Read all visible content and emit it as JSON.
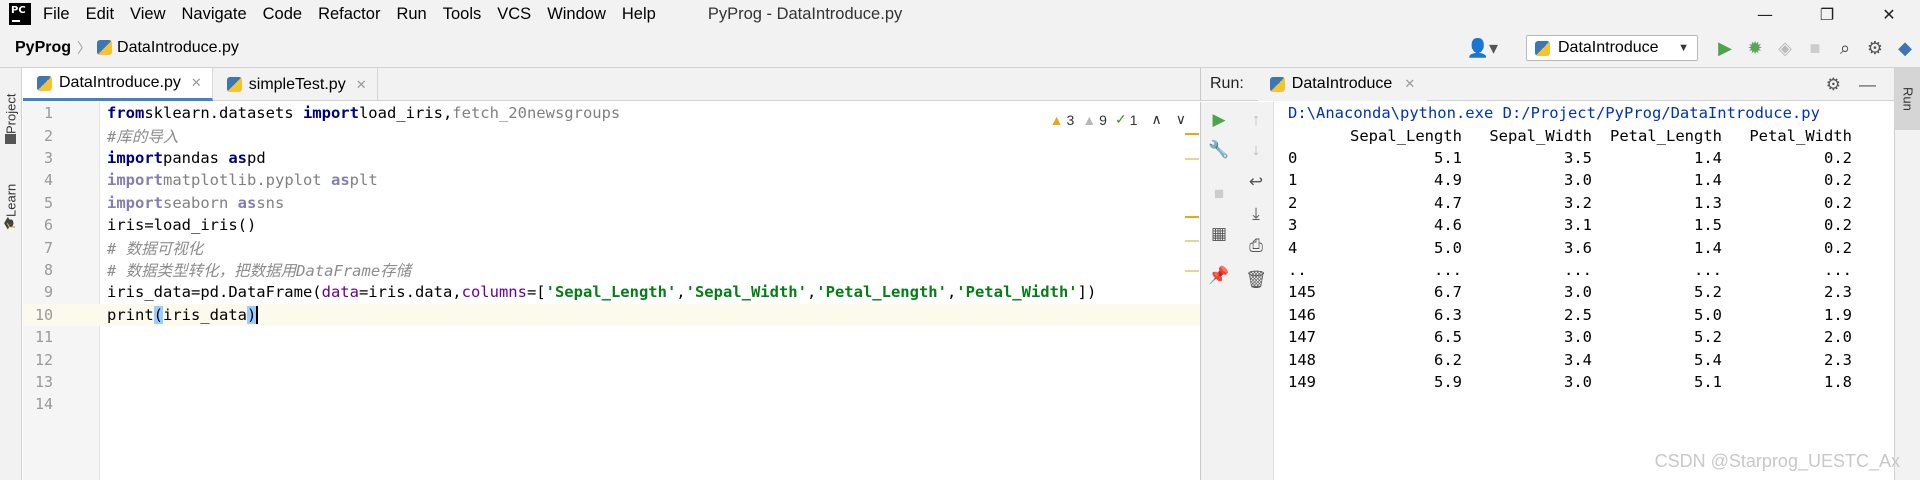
{
  "window": {
    "app_icon": "PC",
    "title": "PyProg - DataIntroduce.py",
    "menu": [
      "File",
      "Edit",
      "View",
      "Navigate",
      "Code",
      "Refactor",
      "Run",
      "Tools",
      "VCS",
      "Window",
      "Help"
    ],
    "controls": {
      "minimize": "—",
      "restore": "❐",
      "close": "✕"
    }
  },
  "navbar": {
    "project": "PyProg",
    "file": "DataIntroduce.py",
    "run_config": "DataIntroduce"
  },
  "left_strip": {
    "project_label": "Project",
    "learn_label": "Learn"
  },
  "editor": {
    "tabs": [
      {
        "label": "DataIntroduce.py",
        "active": true
      },
      {
        "label": "simpleTest.py",
        "active": false
      }
    ],
    "inspections": {
      "warnings": "3",
      "weak_warnings": "9",
      "typos": "1"
    },
    "lines": [
      {
        "n": "1",
        "parts": [
          [
            "kw",
            "from"
          ],
          [
            "",
            "sklearn.datasets "
          ],
          [
            "kw",
            "import"
          ],
          [
            "",
            "load_iris,"
          ],
          [
            "dim",
            "fetch_20newsgroups"
          ]
        ]
      },
      {
        "n": "2",
        "parts": [
          [
            "cmt",
            "#库的导入"
          ]
        ]
      },
      {
        "n": "3",
        "parts": [
          [
            "kw",
            "import"
          ],
          [
            "",
            "pandas "
          ],
          [
            "kw",
            "as"
          ],
          [
            "",
            "pd"
          ]
        ]
      },
      {
        "n": "4",
        "parts": [
          [
            "dimkw",
            "import"
          ],
          [
            "dim",
            "matplotlib.pyplot "
          ],
          [
            "dimkw",
            "as"
          ],
          [
            "dim",
            "plt"
          ]
        ]
      },
      {
        "n": "5",
        "parts": [
          [
            "dimkw",
            "import"
          ],
          [
            "dim",
            "seaborn "
          ],
          [
            "dimkw",
            "as"
          ],
          [
            "dim",
            "sns"
          ]
        ]
      },
      {
        "n": "6",
        "parts": [
          [
            "",
            "iris=load_iris()"
          ]
        ]
      },
      {
        "n": "7",
        "parts": [
          [
            "cmt",
            "# 数据可视化"
          ]
        ]
      },
      {
        "n": "8",
        "parts": [
          [
            "cmt",
            "# 数据类型转化，把数据用DataFrame存储"
          ]
        ]
      },
      {
        "n": "9",
        "parts": [
          [
            "",
            "iris_data=pd.DataFrame("
          ],
          [
            "param",
            "data"
          ],
          [
            "",
            "=iris.data,"
          ],
          [
            "param",
            "columns"
          ],
          [
            "",
            "=["
          ],
          [
            "str",
            "'Sepal_Length'"
          ],
          [
            "",
            ","
          ],
          [
            "str",
            "'Sepal_Width'"
          ],
          [
            "",
            ","
          ],
          [
            "str",
            "'Petal_Length'"
          ],
          [
            "",
            ","
          ],
          [
            "str",
            "'Petal_Width'"
          ],
          [
            "",
            "])"
          ]
        ]
      },
      {
        "n": "10",
        "parts": [
          [
            "",
            "print"
          ],
          [
            "br",
            "("
          ],
          [
            "",
            "iris_data"
          ],
          [
            "br",
            ")"
          ]
        ],
        "current": true
      },
      {
        "n": "11",
        "parts": []
      },
      {
        "n": "12",
        "parts": []
      },
      {
        "n": "13",
        "parts": []
      },
      {
        "n": "14",
        "parts": []
      }
    ]
  },
  "run": {
    "label": "Run:",
    "tab": "DataIntroduce",
    "command": "D:\\Anaconda\\python.exe D:/Project/PyProg/DataIntroduce.py",
    "header": [
      "",
      "Sepal_Length",
      "Sepal_Width",
      "Petal_Length",
      "Petal_Width"
    ],
    "rows": [
      [
        "0",
        "5.1",
        "3.5",
        "1.4",
        "0.2"
      ],
      [
        "1",
        "4.9",
        "3.0",
        "1.4",
        "0.2"
      ],
      [
        "2",
        "4.7",
        "3.2",
        "1.3",
        "0.2"
      ],
      [
        "3",
        "4.6",
        "3.1",
        "1.5",
        "0.2"
      ],
      [
        "4",
        "5.0",
        "3.6",
        "1.4",
        "0.2"
      ],
      [
        "..",
        "...",
        "...",
        "...",
        "..."
      ],
      [
        "145",
        "6.7",
        "3.0",
        "5.2",
        "2.3"
      ],
      [
        "146",
        "6.3",
        "2.5",
        "5.0",
        "1.9"
      ],
      [
        "147",
        "6.5",
        "3.0",
        "5.2",
        "2.0"
      ],
      [
        "148",
        "6.2",
        "3.4",
        "5.4",
        "2.3"
      ],
      [
        "149",
        "5.9",
        "3.0",
        "5.1",
        "1.8"
      ]
    ],
    "side_label": "Run"
  },
  "watermark": "CSDN @Starprog_UESTC_Ax"
}
